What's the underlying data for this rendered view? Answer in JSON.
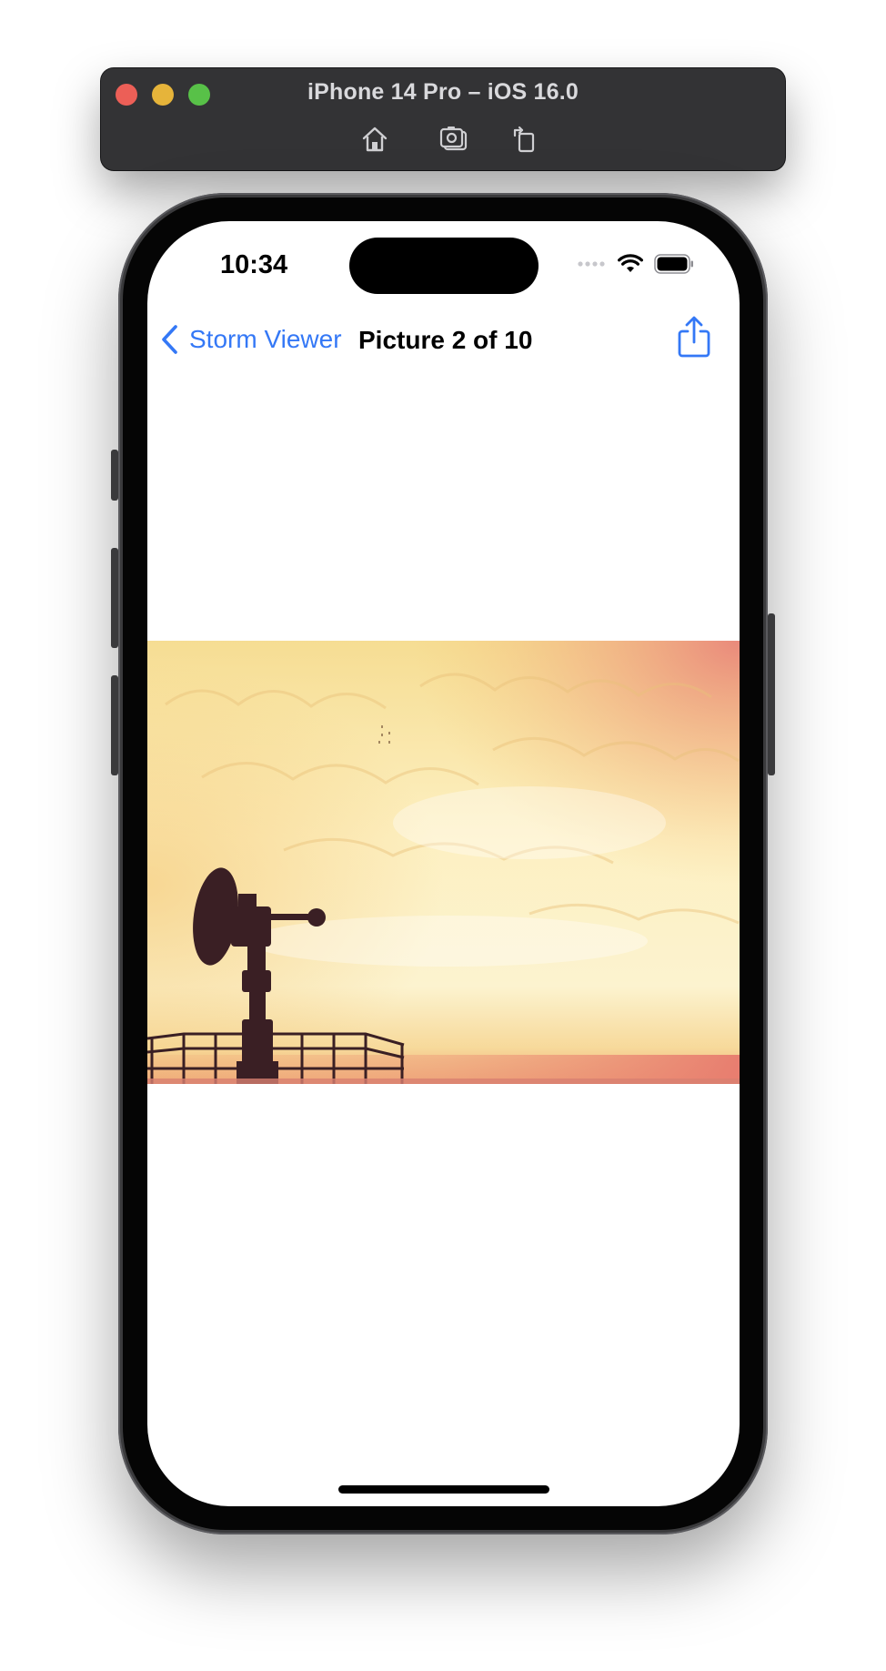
{
  "simulator": {
    "title": "iPhone 14 Pro – iOS 16.0",
    "toolbar": [
      "home-icon",
      "screenshot-icon",
      "rotate-icon"
    ]
  },
  "status_bar": {
    "time": "10:34"
  },
  "nav": {
    "back_label": "Storm Viewer",
    "title": "Picture 2 of 10",
    "share_icon": "share-icon"
  },
  "image": {
    "subject": "radar-dish-silhouette"
  },
  "colors": {
    "accent": "#3478f6",
    "window_chrome": "#333335",
    "sky_light": "#fdf1c4",
    "sky_warm": "#f6c97a",
    "sky_red": "#e9857a"
  }
}
